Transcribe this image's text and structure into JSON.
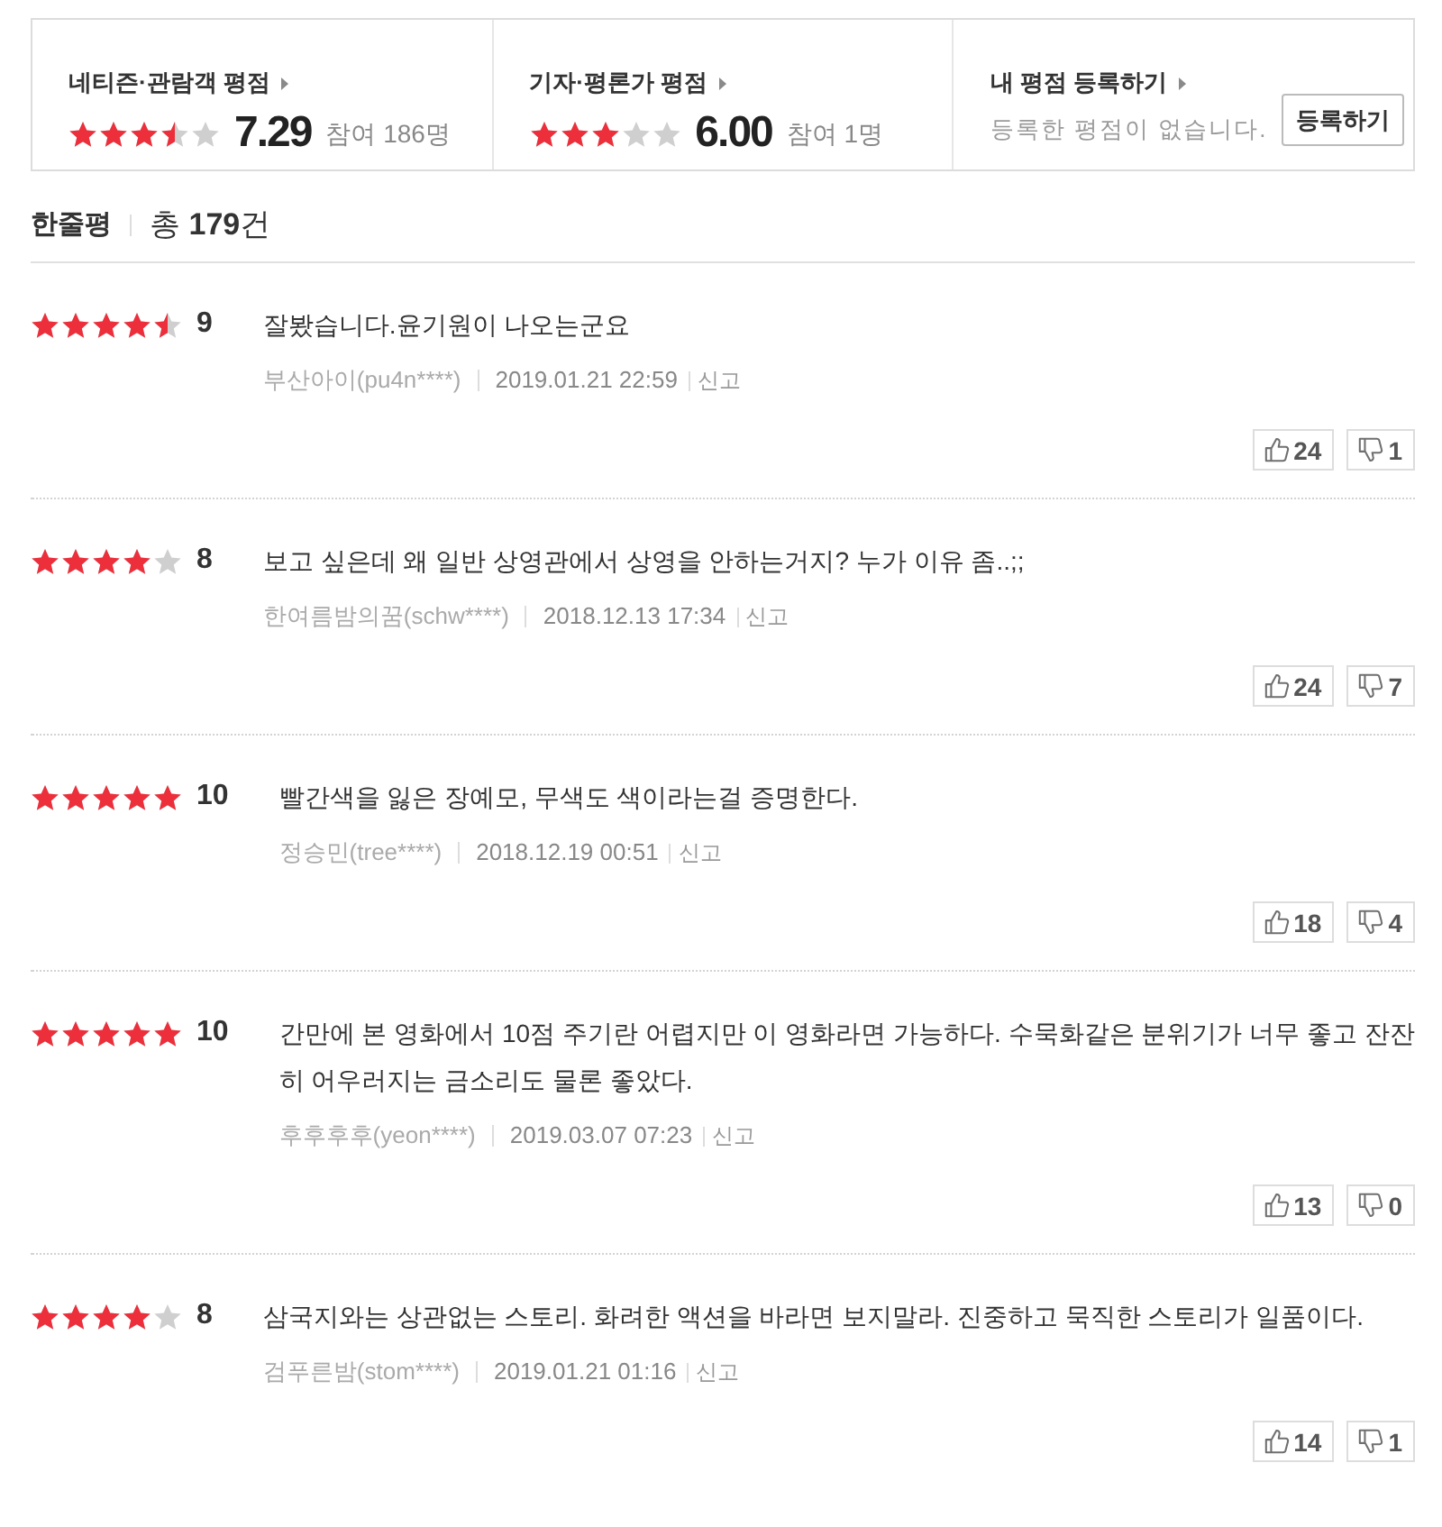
{
  "summary": {
    "panels": [
      {
        "kind": "rating",
        "title": "네티즌·관람객 평점",
        "stars": 3.5,
        "score": "7.29",
        "participants": "참여 186명"
      },
      {
        "kind": "rating",
        "title": "기자·평론가 평점",
        "stars": 3,
        "score": "6.00",
        "participants": "참여 1명"
      },
      {
        "kind": "my_rating",
        "title": "내 평점 등록하기",
        "message": "등록한 평점이 없습니다.",
        "button": "등록하기"
      }
    ]
  },
  "reviews_header": {
    "title": "한줄평",
    "total": "총 **179**건"
  },
  "reviews": [
    {
      "stars": 4.5,
      "score": "9",
      "text": "잘봤습니다.윤기원이 나오는군요",
      "author": "부산아이(pu4n****)",
      "date": "2019.01.21 22:59",
      "report": "신고",
      "likes": "24",
      "dislikes": "1"
    },
    {
      "stars": 4,
      "score": "8",
      "text": "보고 싶은데 왜 일반 상영관에서 상영을 안하는거지? 누가 이유 좀..;;",
      "author": "한여름밤의꿈(schw****)",
      "date": "2018.12.13 17:34",
      "report": "신고",
      "likes": "24",
      "dislikes": "7"
    },
    {
      "stars": 5,
      "score": "10",
      "text": "빨간색을 잃은 장예모, 무색도 색이라는걸 증명한다.",
      "author": "정승민(tree****)",
      "date": "2018.12.19 00:51",
      "report": "신고",
      "likes": "18",
      "dislikes": "4"
    },
    {
      "stars": 5,
      "score": "10",
      "text": "간만에 본 영화에서 10점 주기란 어렵지만 이 영화라면 가능하다. 수묵화같은 분위기가 너무 좋고 잔잔히 어우러지는 금소리도 물론 좋았다.",
      "author": "후후후후(yeon****)",
      "date": "2019.03.07 07:23",
      "report": "신고",
      "likes": "13",
      "dislikes": "0"
    },
    {
      "stars": 4,
      "score": "8",
      "text": "삼국지와는 상관없는 스토리. 화려한 액션을 바라면 보지말라. 진중하고 묵직한 스토리가 일품이다.",
      "author": "검푸른밤(stom****)",
      "date": "2019.01.21 01:16",
      "report": "신고",
      "likes": "14",
      "dislikes": "1"
    }
  ]
}
